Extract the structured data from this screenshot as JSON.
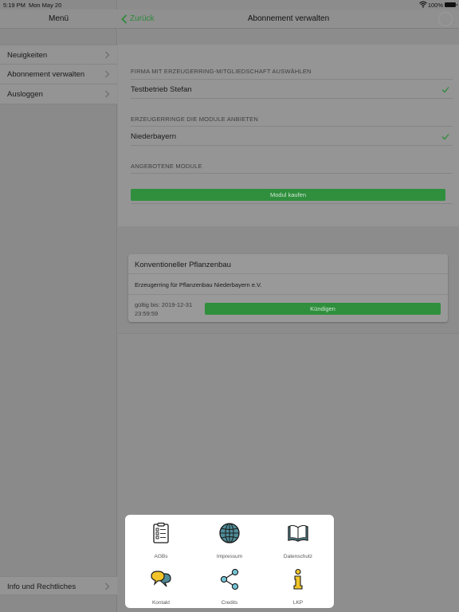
{
  "status_bar": {
    "time": "5:19 PM",
    "date": "Mon May 20",
    "battery": "100%"
  },
  "sidebar": {
    "title": "Menü",
    "items": [
      {
        "label": "Neuigkeiten"
      },
      {
        "label": "Abonnement verwalten"
      },
      {
        "label": "Ausloggen"
      }
    ],
    "bottom_item": {
      "label": "Info und Rechtliches"
    }
  },
  "navbar": {
    "back_label": "Zurück",
    "title": "Abonnement verwalten"
  },
  "form": {
    "section_company": "FIRMA MIT ERZEUGERRING-MITGLIEDSCHAFT AUSWÄHLEN",
    "company_value": "Testbetrieb Stefan",
    "section_rings": "ERZEUGERRINGE DIE MODULE ANBIETEN",
    "ring_value": "Niederbayern",
    "section_modules": "ANGEBOTENE MODULE",
    "buy_button": "Modul kaufen"
  },
  "subscription": {
    "title": "Konventioneller Pflanzenbau",
    "organization": "Erzeugerring für Pflanzenbau Niederbayern e.V.",
    "valid_until": "gültig bis: 2019-12-31 23:59:59",
    "cancel_button": "Kündigen"
  },
  "popup": {
    "items": [
      {
        "label": "AGBs",
        "icon": "clipboard-checklist-icon"
      },
      {
        "label": "Impressum",
        "icon": "globe-icon"
      },
      {
        "label": "Datenschutz",
        "icon": "open-book-icon"
      },
      {
        "label": "Kontakt",
        "icon": "speech-bubbles-icon"
      },
      {
        "label": "Credits",
        "icon": "share-icon"
      },
      {
        "label": "LKP",
        "icon": "info-icon"
      }
    ]
  },
  "colors": {
    "accent_green": "#34c759",
    "popup_bg": "#ffffff"
  }
}
